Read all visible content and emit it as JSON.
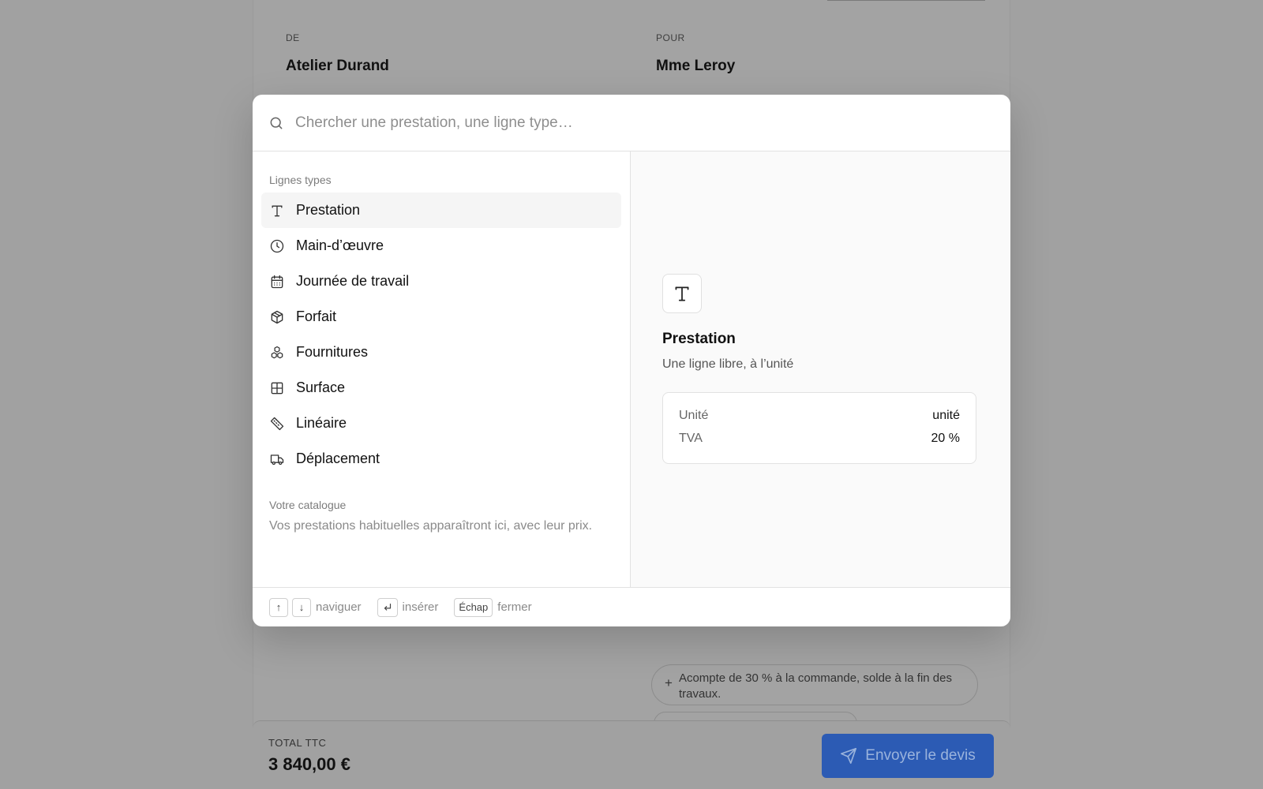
{
  "document": {
    "from_label": "DE",
    "from_name": "Atelier Durand",
    "to_label": "POUR",
    "to_name": "Mme Leroy",
    "payment_note": "Acompte de 30 % à la commande, solde à la fin des travaux."
  },
  "bottom_bar": {
    "total_label": "TOTAL TTC",
    "total_value": "3 840,00 €",
    "send_label": "Envoyer le devis"
  },
  "modal": {
    "search_placeholder": "Chercher une prestation, une ligne type…",
    "section_types": "Lignes types",
    "items": [
      {
        "label": "Prestation",
        "icon": "text-icon"
      },
      {
        "label": "Main-d’œuvre",
        "icon": "clock-icon"
      },
      {
        "label": "Journée de travail",
        "icon": "calendar-icon"
      },
      {
        "label": "Forfait",
        "icon": "package-icon"
      },
      {
        "label": "Fournitures",
        "icon": "boxes-icon"
      },
      {
        "label": "Surface",
        "icon": "grid-icon"
      },
      {
        "label": "Linéaire",
        "icon": "ruler-icon"
      },
      {
        "label": "Déplacement",
        "icon": "truck-icon"
      }
    ],
    "section_catalog": "Votre catalogue",
    "catalog_hint": "Vos prestations habituelles apparaîtront ici, avec leur prix.",
    "preview": {
      "title": "Prestation",
      "description": "Une ligne libre, à l’unité",
      "unit_label": "Unité",
      "unit_value": "unité",
      "vat_label": "TVA",
      "vat_value": "20 %"
    },
    "footer": {
      "up_key": "↑",
      "down_key": "↓",
      "navigate": "naviguer",
      "insert": "insérer",
      "escape_key": "Échap",
      "close": "fermer"
    }
  }
}
